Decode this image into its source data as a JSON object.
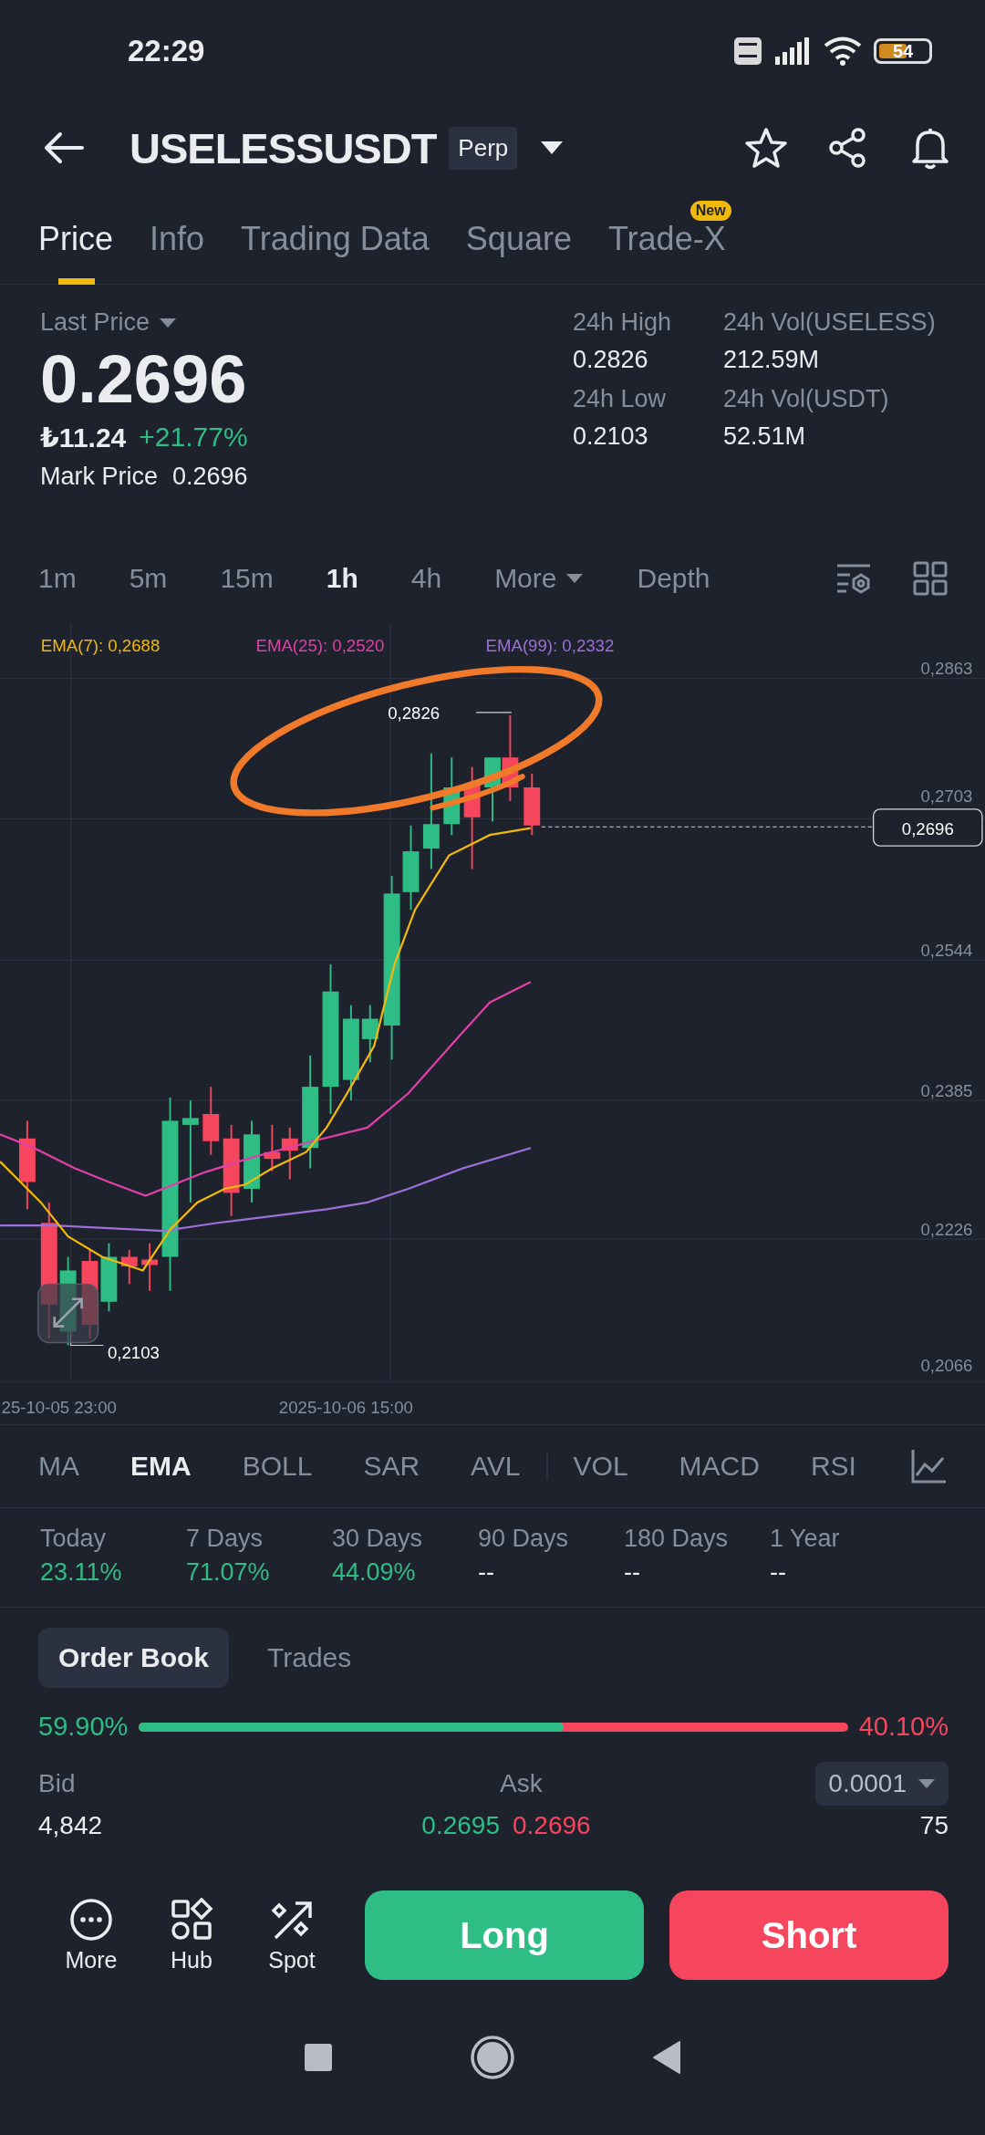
{
  "status_bar": {
    "time": "22:29",
    "battery": "54"
  },
  "header": {
    "symbol": "USELESSUSDT",
    "contract_type": "Perp"
  },
  "tabs": [
    {
      "label": "Price",
      "selected": true
    },
    {
      "label": "Info",
      "selected": false
    },
    {
      "label": "Trading Data",
      "selected": false
    },
    {
      "label": "Square",
      "selected": false
    },
    {
      "label": "Trade-X",
      "selected": false,
      "badge": "New"
    }
  ],
  "ticker": {
    "last_price_label": "Last Price",
    "last_price": "0.2696",
    "local_price": "₺11.24",
    "change": "+21.77%",
    "mark_price_label": "Mark Price",
    "mark_price": "0.2696",
    "stats": [
      {
        "label": "24h High",
        "value": "0.2826"
      },
      {
        "label": "24h Vol(USELESS)",
        "value": "212.59M"
      },
      {
        "label": "24h Low",
        "value": "0.2103"
      },
      {
        "label": "24h Vol(USDT)",
        "value": "52.51M"
      }
    ]
  },
  "intervals": [
    {
      "label": "1m",
      "selected": false,
      "kind": "plain"
    },
    {
      "label": "5m",
      "selected": false,
      "kind": "plain"
    },
    {
      "label": "15m",
      "selected": false,
      "kind": "plain"
    },
    {
      "label": "1h",
      "selected": true,
      "kind": "plain"
    },
    {
      "label": "4h",
      "selected": false,
      "kind": "plain"
    },
    {
      "label": "More",
      "selected": false,
      "kind": "dropdown"
    },
    {
      "label": "Depth",
      "selected": false,
      "kind": "plain"
    }
  ],
  "chart": {
    "ema_legend": [
      {
        "label": "EMA(7): 0,2688",
        "color": "#f0b90b"
      },
      {
        "label": "EMA(25): 0,2520",
        "color": "#e040a8"
      },
      {
        "label": "EMA(99): 0,2332",
        "color": "#9d6fd8"
      }
    ],
    "price_labels": [
      "0,2863",
      "0,2703",
      "0,2544",
      "0,2385",
      "0,2226",
      "0,2066"
    ],
    "high_marker": "0,2826",
    "low_marker": "0,2103",
    "current_price": "0,2696",
    "time_labels": [
      "25-10-05 23:00",
      "2025-10-06 15:00"
    ]
  },
  "indicators": {
    "main": [
      {
        "label": "MA",
        "selected": false
      },
      {
        "label": "EMA",
        "selected": true
      },
      {
        "label": "BOLL",
        "selected": false
      },
      {
        "label": "SAR",
        "selected": false
      },
      {
        "label": "AVL",
        "selected": false
      }
    ],
    "sub": [
      {
        "label": "VOL",
        "selected": false
      },
      {
        "label": "MACD",
        "selected": false
      },
      {
        "label": "RSI",
        "selected": false
      }
    ]
  },
  "performance": [
    {
      "label": "Today",
      "value": "23.11%",
      "color": "#2ebd85"
    },
    {
      "label": "7 Days",
      "value": "71.07%",
      "color": "#2ebd85"
    },
    {
      "label": "30 Days",
      "value": "44.09%",
      "color": "#2ebd85"
    },
    {
      "label": "90 Days",
      "value": "--",
      "color": "#eaecef"
    },
    {
      "label": "180 Days",
      "value": "--",
      "color": "#eaecef"
    },
    {
      "label": "1 Year",
      "value": "--",
      "color": "#eaecef"
    }
  ],
  "order_book": {
    "tabs": [
      {
        "label": "Order Book",
        "selected": true
      },
      {
        "label": "Trades",
        "selected": false
      }
    ],
    "bid_ratio": "59.90%",
    "ask_ratio": "40.10%",
    "level": 0.599,
    "bid_label": "Bid",
    "ask_label": "Ask",
    "precision": "0.0001",
    "rows": [
      {
        "bid_qty": "4,842",
        "bid_price": "0.2695",
        "ask_price": "0.2696",
        "ask_qty": "75"
      }
    ]
  },
  "bottom_bar": {
    "actions": [
      {
        "label": "More",
        "kind": "more"
      },
      {
        "label": "Hub",
        "kind": "hub"
      },
      {
        "label": "Spot",
        "kind": "spot"
      }
    ],
    "buttons": [
      {
        "label": "Long",
        "kind": "buy"
      },
      {
        "label": "Short",
        "kind": "sell"
      }
    ]
  }
}
